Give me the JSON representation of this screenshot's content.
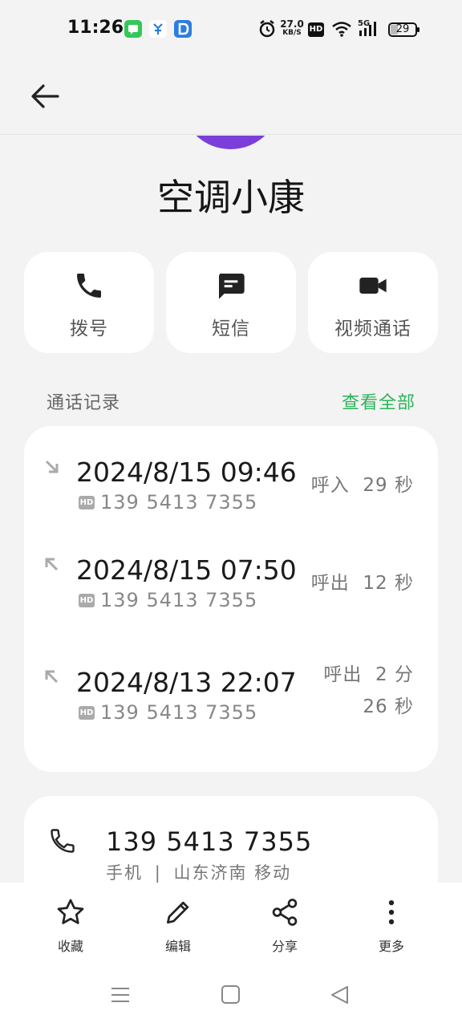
{
  "status": {
    "time": "11:26",
    "speed_value": "27.0",
    "speed_unit": "KB/S",
    "hd": "HD",
    "network": "5G",
    "battery": "29"
  },
  "contact": {
    "name": "空调小康"
  },
  "actions": [
    {
      "label": "拨号",
      "icon": "phone-icon"
    },
    {
      "label": "短信",
      "icon": "message-icon"
    },
    {
      "label": "视频通话",
      "icon": "video-icon"
    }
  ],
  "call_log": {
    "title": "通话记录",
    "view_all": "查看全部",
    "entries": [
      {
        "datetime": "2024/8/15 09:46",
        "badge": "HD",
        "number": "139 5413 7355",
        "direction": "incoming",
        "duration": "呼入  29 秒"
      },
      {
        "datetime": "2024/8/15 07:50",
        "badge": "HD",
        "number": "139 5413 7355",
        "direction": "outgoing",
        "duration": "呼出  12 秒"
      },
      {
        "datetime": "2024/8/13 22:07",
        "badge": "HD",
        "number": "139 5413 7355",
        "direction": "outgoing",
        "duration_line1": "呼出  2 分",
        "duration_line2": "26 秒"
      }
    ]
  },
  "phone": {
    "number": "139 5413 7355",
    "type": "手机",
    "separator": "|",
    "location": "山东济南 移动"
  },
  "bottom": [
    {
      "label": "收藏",
      "icon": "star-icon"
    },
    {
      "label": "编辑",
      "icon": "pencil-icon"
    },
    {
      "label": "分享",
      "icon": "share-icon"
    },
    {
      "label": "更多",
      "icon": "more-icon"
    }
  ],
  "colors": {
    "accent_green": "#2bb45a",
    "avatar": "#7b3fd9"
  }
}
